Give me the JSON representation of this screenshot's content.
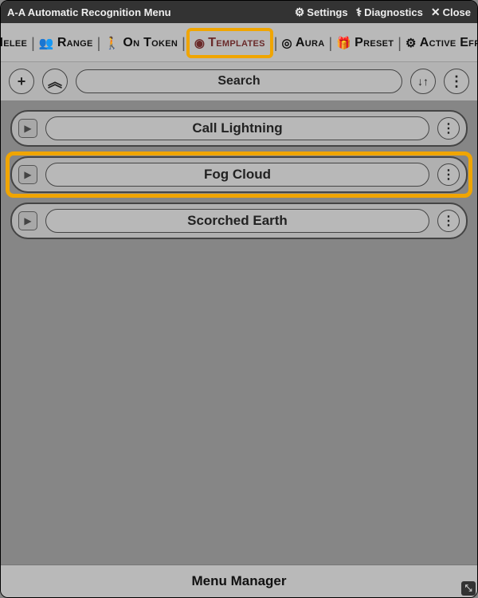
{
  "window": {
    "title": "A-A Automatic Recognition Menu"
  },
  "titlebar_buttons": {
    "settings": "Settings",
    "diagnostics": "Diagnostics",
    "close": "Close"
  },
  "tabs": [
    {
      "id": "melee",
      "label": "Melee",
      "icon": "🛡"
    },
    {
      "id": "range",
      "label": "Range",
      "icon": "👥"
    },
    {
      "id": "ontoken",
      "label": "On Token",
      "icon": "🚶"
    },
    {
      "id": "templates",
      "label": "Templates",
      "icon": "◉",
      "active": true
    },
    {
      "id": "aura",
      "label": "Aura",
      "icon": "◎"
    },
    {
      "id": "preset",
      "label": "Preset",
      "icon": "🎁"
    },
    {
      "id": "activeeffects",
      "label": "Active Effects",
      "icon": "⚙"
    }
  ],
  "toolbar": {
    "search_placeholder": "Search",
    "add": "+",
    "collapse": "︽",
    "sort": "↓↑",
    "menu": "⋮"
  },
  "items": [
    {
      "label": "Call Lightning"
    },
    {
      "label": "Fog Cloud",
      "highlighted": true
    },
    {
      "label": "Scorched Earth"
    }
  ],
  "footer": {
    "label": "Menu Manager"
  },
  "glyphs": {
    "expand": "▶",
    "kebab": "⋮",
    "gear": "⚙",
    "steth": "⚕",
    "close": "✕",
    "resize": "⤡"
  }
}
